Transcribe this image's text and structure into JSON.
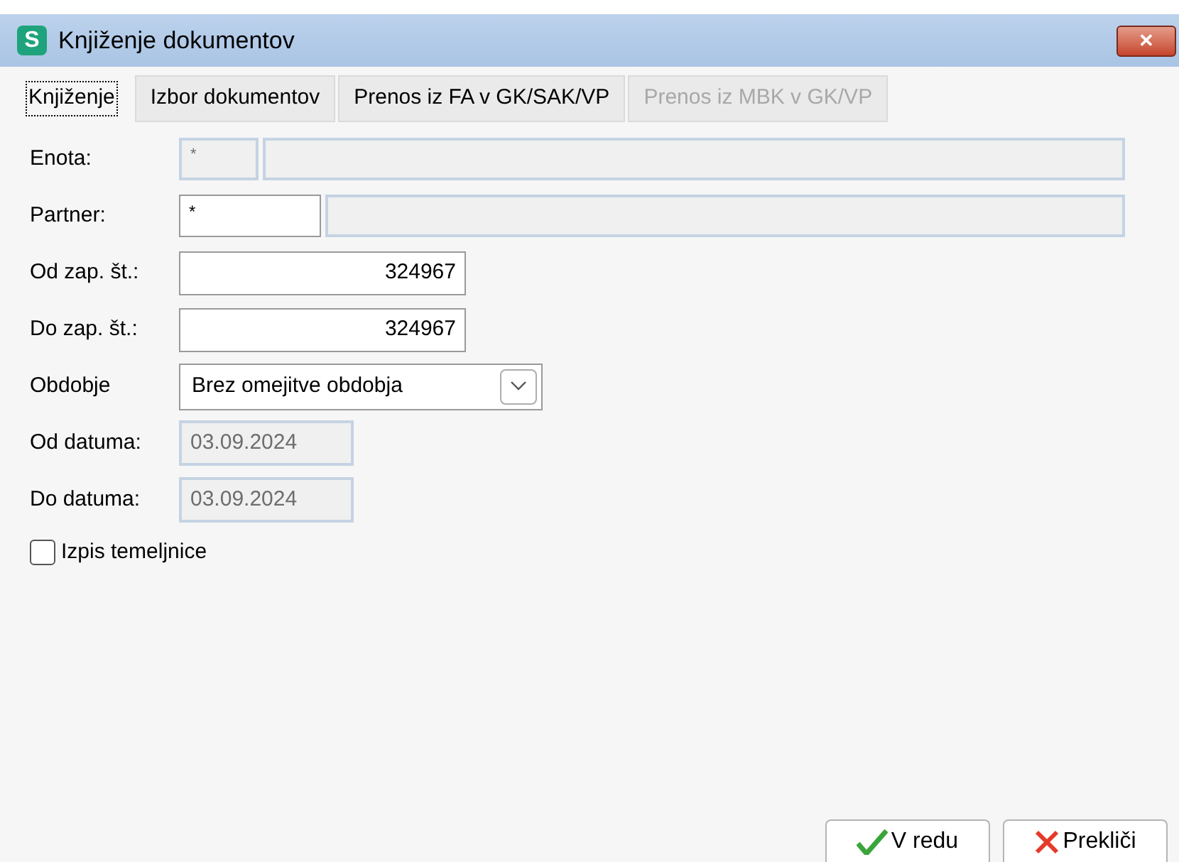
{
  "window": {
    "title": "Knjiženje dokumentov",
    "logo": "S",
    "close": "✕"
  },
  "tabs": [
    {
      "label": "Knjiženje",
      "selected": true,
      "disabled": false
    },
    {
      "label": "Izbor dokumentov",
      "selected": false,
      "disabled": false
    },
    {
      "label": "Prenos iz FA v GK/SAK/VP",
      "selected": false,
      "disabled": false
    },
    {
      "label": "Prenos iz MBK v GK/VP",
      "selected": false,
      "disabled": true
    }
  ],
  "fields": [
    {
      "kind": "lookup",
      "label": "Enota:",
      "code": "*",
      "code_disabled": true
    },
    {
      "kind": "lookup",
      "label": "Partner:",
      "code": "*",
      "code_disabled": false
    },
    {
      "kind": "number",
      "label": "Od zap. št.:",
      "value": "324967",
      "disabled": false
    },
    {
      "kind": "number",
      "label": "Do zap. št.:",
      "value": "324967",
      "disabled": false
    },
    {
      "kind": "select",
      "label": "Obdobje",
      "value": "Brez omejitve obdobja",
      "disabled": false
    },
    {
      "kind": "date",
      "label": "Od datuma:",
      "value": "03.09.2024",
      "disabled": true
    },
    {
      "kind": "date",
      "label": "Do datuma:",
      "value": "03.09.2024",
      "disabled": true
    }
  ],
  "checkbox": {
    "label": "Izpis temeljnice",
    "checked": false
  },
  "buttons": [
    {
      "kind": "ok",
      "label": "V redu"
    },
    {
      "kind": "cancel",
      "label": "Prekliči"
    }
  ]
}
